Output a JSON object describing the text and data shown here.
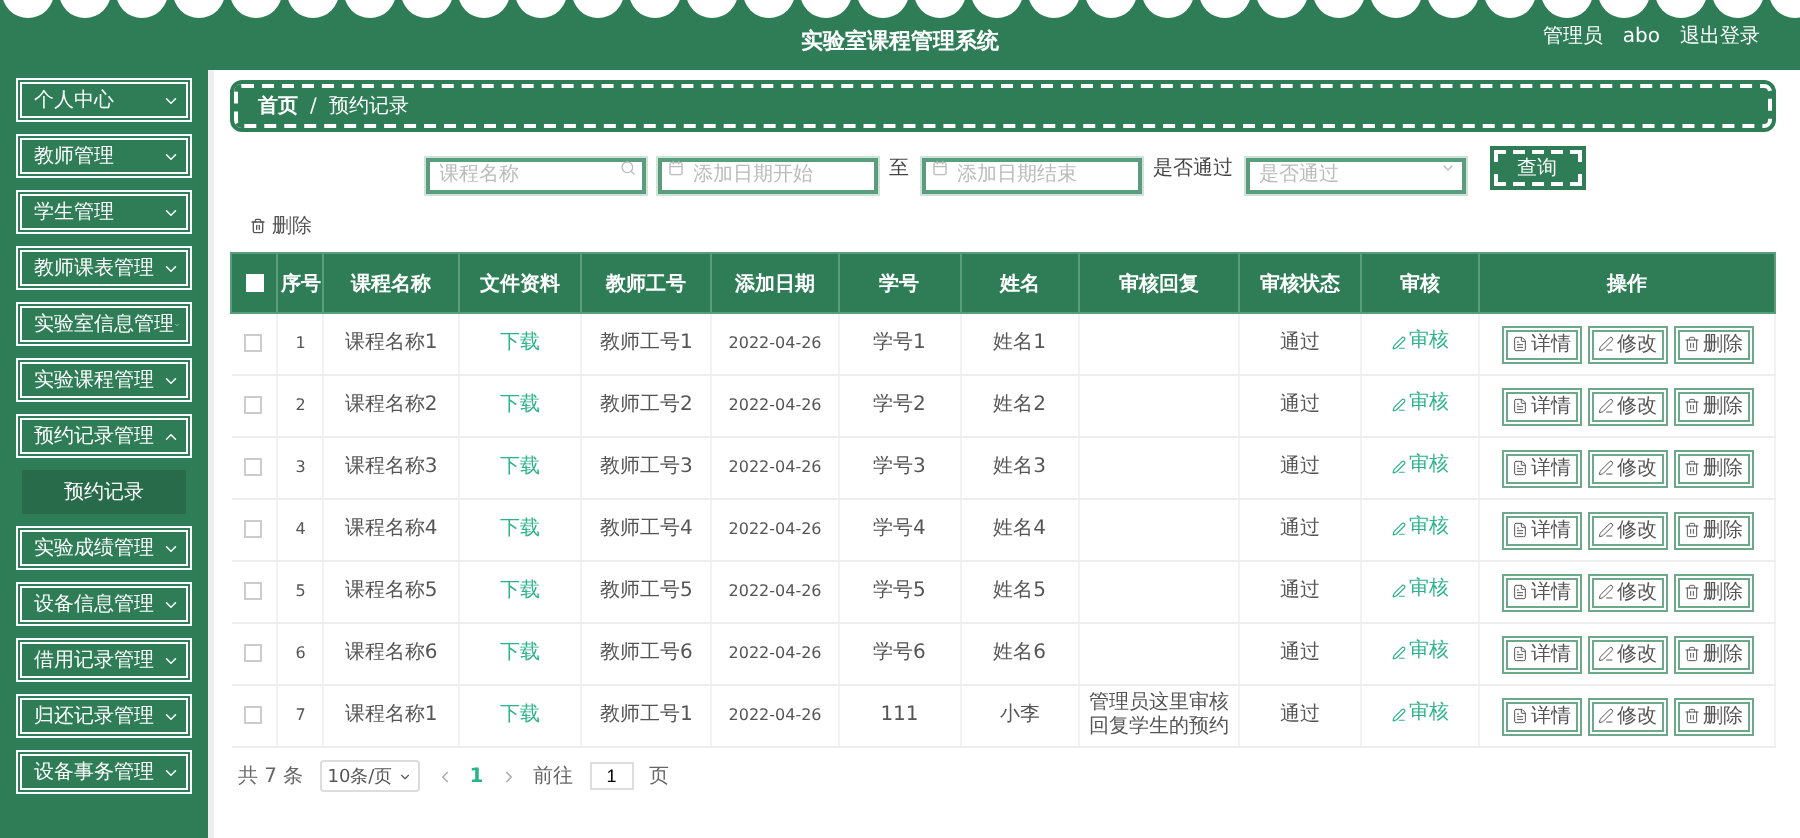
{
  "header": {
    "title": "实验室课程管理系统",
    "user_role": "管理员",
    "user_name": "abo",
    "logout": "退出登录"
  },
  "sidebar": {
    "items": [
      {
        "label": "个人中心",
        "expanded": false
      },
      {
        "label": "教师管理",
        "expanded": false
      },
      {
        "label": "学生管理",
        "expanded": false
      },
      {
        "label": "教师课表管理",
        "expanded": false
      },
      {
        "label": "实验室信息管理",
        "expanded": false
      },
      {
        "label": "实验课程管理",
        "expanded": false
      },
      {
        "label": "预约记录管理",
        "expanded": true,
        "children": [
          {
            "label": "预约记录",
            "selected": true
          }
        ]
      },
      {
        "label": "实验成绩管理",
        "expanded": false
      },
      {
        "label": "设备信息管理",
        "expanded": false
      },
      {
        "label": "借用记录管理",
        "expanded": false
      },
      {
        "label": "归还记录管理",
        "expanded": false
      },
      {
        "label": "设备事务管理",
        "expanded": false
      }
    ]
  },
  "breadcrumb": {
    "items": [
      "首页",
      "预约记录"
    ],
    "separator": "/"
  },
  "search": {
    "course": {
      "placeholder": "课程名称"
    },
    "date_start": {
      "placeholder": "添加日期开始"
    },
    "separator": "至",
    "date_end": {
      "placeholder": "添加日期结束"
    },
    "passed_label": "是否通过",
    "passed": {
      "placeholder": "是否通过"
    },
    "button": "查询"
  },
  "toolbar": {
    "delete": "删除"
  },
  "table": {
    "header_checked": false,
    "columns": [
      "序号",
      "课程名称",
      "文件资料",
      "教师工号",
      "添加日期",
      "学号",
      "姓名",
      "审核回复",
      "审核状态",
      "审核",
      "操作"
    ],
    "rows": [
      {
        "checked": false,
        "index": "1",
        "course": "课程名称1",
        "file": "下载",
        "teacher_no": "教师工号1",
        "date": "2022-04-26",
        "student_no": "学号1",
        "name": "姓名1",
        "status": "通过",
        "audit": "审核",
        "actions": [
          "详情",
          "修改",
          "删除"
        ]
      },
      {
        "checked": false,
        "index": "2",
        "course": "课程名称2",
        "file": "下载",
        "teacher_no": "教师工号2",
        "date": "2022-04-26",
        "student_no": "学号2",
        "name": "姓名2",
        "status": "通过",
        "audit": "审核",
        "actions": [
          "详情",
          "修改",
          "删除"
        ]
      },
      {
        "checked": false,
        "index": "3",
        "course": "课程名称3",
        "file": "下载",
        "teacher_no": "教师工号3",
        "date": "2022-04-26",
        "student_no": "学号3",
        "name": "姓名3",
        "status": "通过",
        "audit": "审核",
        "actions": [
          "详情",
          "修改",
          "删除"
        ]
      },
      {
        "checked": false,
        "index": "4",
        "course": "课程名称4",
        "file": "下载",
        "teacher_no": "教师工号4",
        "date": "2022-04-26",
        "student_no": "学号4",
        "name": "姓名4",
        "status": "通过",
        "audit": "审核",
        "actions": [
          "详情",
          "修改",
          "删除"
        ]
      },
      {
        "checked": false,
        "index": "5",
        "course": "课程名称5",
        "file": "下载",
        "teacher_no": "教师工号5",
        "date": "2022-04-26",
        "student_no": "学号5",
        "name": "姓名5",
        "status": "通过",
        "audit": "审核",
        "actions": [
          "详情",
          "修改",
          "删除"
        ]
      },
      {
        "checked": false,
        "index": "6",
        "course": "课程名称6",
        "file": "下载",
        "teacher_no": "教师工号6",
        "date": "2022-04-26",
        "student_no": "学号6",
        "name": "姓名6",
        "status": "通过",
        "audit": "审核",
        "actions": [
          "详情",
          "修改",
          "删除"
        ]
      },
      {
        "checked": false,
        "index": "7",
        "course": "课程名称1",
        "file": "下载",
        "teacher_no": "教师工号1",
        "date": "2022-04-26",
        "student_no": "111",
        "name": "小李",
        "reply": "管理员这里审核回复学生的预约",
        "status": "通过",
        "audit": "审核",
        "actions": [
          "详情",
          "修改",
          "删除"
        ]
      }
    ]
  },
  "pagination": {
    "total": "共 7 条",
    "page_size": "10条/页",
    "pages": [
      {
        "label": "1",
        "selected": true
      }
    ],
    "goto_label": "前往",
    "goto_value": "1",
    "goto_suffix": "页"
  }
}
